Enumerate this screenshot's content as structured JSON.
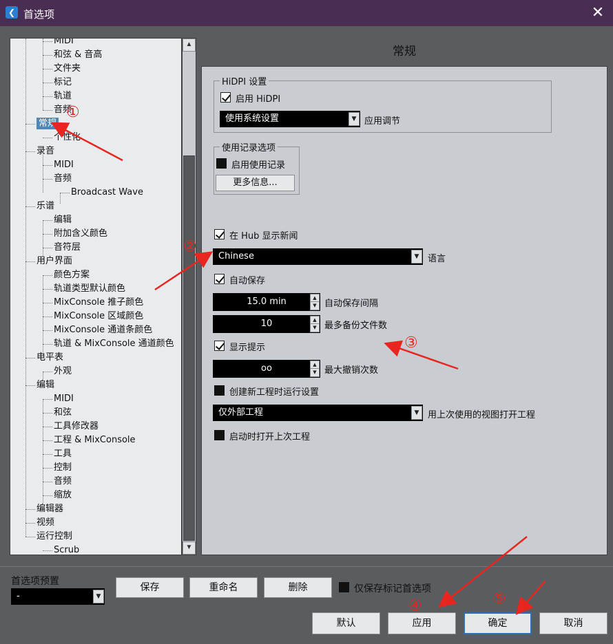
{
  "window": {
    "title": "首选项",
    "close_glyph": "✕"
  },
  "tree": {
    "items": [
      {
        "label": "MIDI",
        "level": 2,
        "clipped": true
      },
      {
        "label": "和弦 & 音高",
        "level": 2
      },
      {
        "label": "文件夹",
        "level": 2
      },
      {
        "label": "标记",
        "level": 2
      },
      {
        "label": "轨道",
        "level": 2
      },
      {
        "label": "音频",
        "level": 2
      },
      {
        "label": "常规",
        "level": 1,
        "selected": true
      },
      {
        "label": "个性化",
        "level": 2
      },
      {
        "label": "录音",
        "level": 1
      },
      {
        "label": "MIDI",
        "level": 2
      },
      {
        "label": "音频",
        "level": 2
      },
      {
        "label": "Broadcast Wave",
        "level": 3
      },
      {
        "label": "乐谱",
        "level": 1
      },
      {
        "label": "编辑",
        "level": 2
      },
      {
        "label": "附加含义颜色",
        "level": 2
      },
      {
        "label": "音符层",
        "level": 2
      },
      {
        "label": "用户界面",
        "level": 1
      },
      {
        "label": "颜色方案",
        "level": 2
      },
      {
        "label": "轨道类型默认颜色",
        "level": 2
      },
      {
        "label": "MixConsole 推子颜色",
        "level": 2
      },
      {
        "label": "MixConsole 区域颜色",
        "level": 2
      },
      {
        "label": "MixConsole 通道条颜色",
        "level": 2
      },
      {
        "label": "轨道 & MixConsole 通道颜色",
        "level": 2
      },
      {
        "label": "电平表",
        "level": 1
      },
      {
        "label": "外观",
        "level": 2
      },
      {
        "label": "编辑",
        "level": 1
      },
      {
        "label": "MIDI",
        "level": 2
      },
      {
        "label": "和弦",
        "level": 2
      },
      {
        "label": "工具修改器",
        "level": 2
      },
      {
        "label": "工程 & MixConsole",
        "level": 2
      },
      {
        "label": "工具",
        "level": 2
      },
      {
        "label": "控制",
        "level": 2
      },
      {
        "label": "音频",
        "level": 2
      },
      {
        "label": "缩放",
        "level": 2
      },
      {
        "label": "编辑器",
        "level": 1
      },
      {
        "label": "视频",
        "level": 1
      },
      {
        "label": "运行控制",
        "level": 1
      },
      {
        "label": "Scrub",
        "level": 2
      }
    ]
  },
  "scroll": {
    "up_glyph": "▲",
    "down_glyph": "▼"
  },
  "page": {
    "heading": "常规",
    "hidpi": {
      "legend": "HiDPI 设置",
      "enable_label": "启用 HiDPI",
      "enable_checked": true,
      "scaling_value": "使用系统设置",
      "scaling_label": "应用调节"
    },
    "usage": {
      "legend": "使用记录选项",
      "enable_label": "启用使用记录",
      "enable_checked": false,
      "more_button": "更多信息..."
    },
    "hub_news": {
      "label": "在 Hub 显示新闻",
      "checked": true
    },
    "language": {
      "value": "Chinese",
      "label": "语言"
    },
    "autosave": {
      "label": "自动保存",
      "checked": true
    },
    "autosave_interval": {
      "value": "15.0 min",
      "label": "自动保存间隔"
    },
    "max_backups": {
      "value": "10",
      "label": "最多备份文件数"
    },
    "show_tips": {
      "label": "显示提示",
      "checked": true
    },
    "max_undo": {
      "value": "oo",
      "label": "最大撤销次数"
    },
    "run_setup": {
      "label": "创建新工程时运行设置",
      "checked": false
    },
    "open_project": {
      "value": "仅外部工程",
      "label": "用上次使用的视图打开工程"
    },
    "open_last": {
      "label": "启动时打开上次工程",
      "checked": false
    }
  },
  "footer": {
    "preset_label": "首选项预置",
    "preset_value": "-",
    "save": "保存",
    "rename": "重命名",
    "delete": "删除",
    "save_marked_label": "仅保存标记首选项",
    "save_marked_checked": false,
    "default": "默认",
    "apply": "应用",
    "ok": "确定",
    "cancel": "取消"
  },
  "annotations": {
    "n1": "①",
    "n2": "②",
    "n3": "③",
    "n4": "④",
    "n5": "⑤",
    "color": "#e8261f"
  },
  "icons": {
    "app": "cubase-icon",
    "dropdown": "chevron-down-icon"
  }
}
